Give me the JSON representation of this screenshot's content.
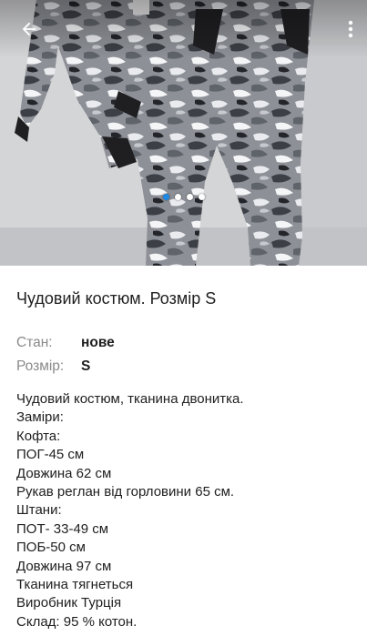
{
  "listing": {
    "title": "Чудовий костюм. Розмір S",
    "params": [
      {
        "label": "Стан:",
        "value": "нове"
      },
      {
        "label": "Розмір:",
        "value": "S"
      }
    ],
    "description_lines": [
      "Чудовий костюм, тканина двонитка.",
      "Заміри:",
      "Кофта:",
      "ПОГ-45 см",
      "Довжина 62 см",
      "Рукав реглан від горловини 65 см.",
      "Штани:",
      "ПОТ- 33-49 см",
      "ПОБ-50 см",
      "Довжина 97 см",
      "Тканина тягнеться",
      "Виробник Турція",
      "Склад: 95 % котон."
    ]
  },
  "gallery": {
    "image_count": 4,
    "active_index": 0
  },
  "icons": {
    "back": "arrow-left-icon",
    "menu": "more-vertical-icon"
  },
  "colors": {
    "accent": "#1e88e5",
    "text": "#202020",
    "label": "#8a8a8a"
  }
}
